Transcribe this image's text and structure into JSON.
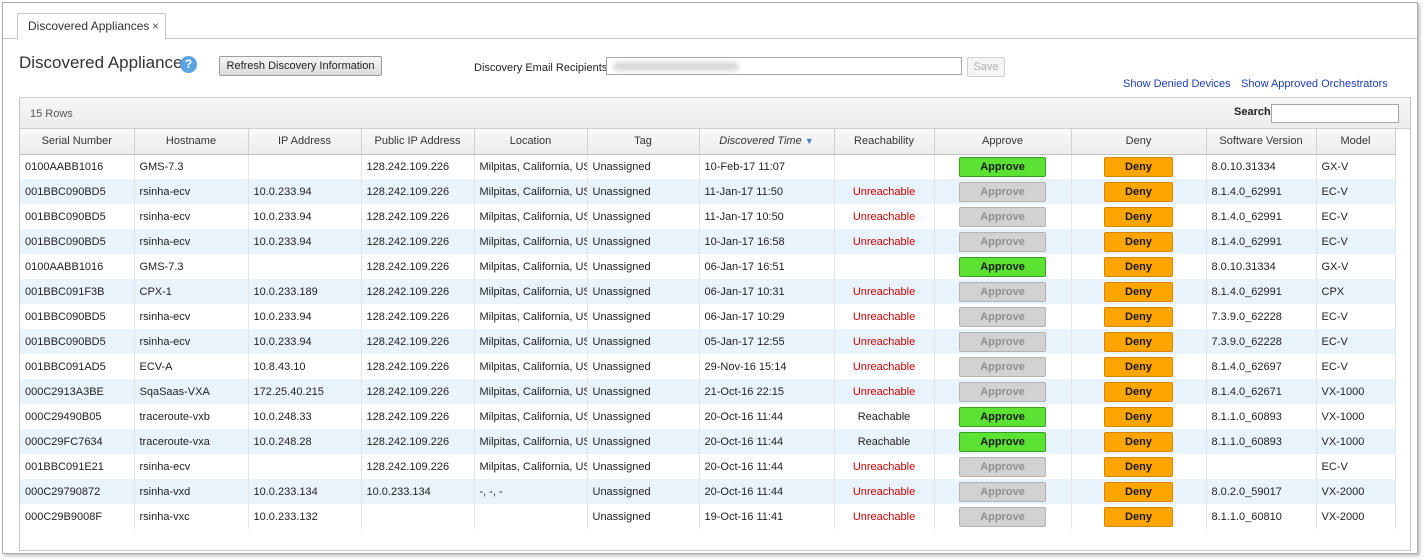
{
  "tab": {
    "label": "Discovered Appliances",
    "close": "×"
  },
  "page": {
    "title": "Discovered Appliances",
    "help": "?",
    "refresh_label": "Refresh Discovery Information",
    "email_label": "Discovery Email Recipients",
    "email_value": "",
    "save_label": "Save",
    "link_denied": "Show Denied Devices",
    "link_orchestrators": "Show Approved Orchestrators"
  },
  "grid": {
    "rows_label": "15 Rows",
    "search_label": "Search",
    "search_value": "",
    "sort_indicator": "▼",
    "columns": [
      "Serial Number",
      "Hostname",
      "IP Address",
      "Public IP Address",
      "Location",
      "Tag",
      "Discovered Time",
      "Reachability",
      "Approve",
      "Deny",
      "Software Version",
      "Model"
    ],
    "rows": [
      {
        "serial": "0100AABB1016",
        "host": "GMS-7.3",
        "ip": "",
        "pubip": "128.242.109.226",
        "loc": "Milpitas, California, US",
        "tag": "Unassigned",
        "time": "10-Feb-17 11:07",
        "reach": "",
        "approve": "Approve",
        "approve_enabled": true,
        "deny": "Deny",
        "ver": "8.0.10.31334",
        "model": "GX-V"
      },
      {
        "serial": "001BBC090BD5",
        "host": "rsinha-ecv",
        "ip": "10.0.233.94",
        "pubip": "128.242.109.226",
        "loc": "Milpitas, California, US",
        "tag": "Unassigned",
        "time": "11-Jan-17 11:50",
        "reach": "Unreachable",
        "approve": "Approve",
        "approve_enabled": false,
        "deny": "Deny",
        "ver": "8.1.4.0_62991",
        "model": "EC-V"
      },
      {
        "serial": "001BBC090BD5",
        "host": "rsinha-ecv",
        "ip": "10.0.233.94",
        "pubip": "128.242.109.226",
        "loc": "Milpitas, California, US",
        "tag": "Unassigned",
        "time": "11-Jan-17 10:50",
        "reach": "Unreachable",
        "approve": "Approve",
        "approve_enabled": false,
        "deny": "Deny",
        "ver": "8.1.4.0_62991",
        "model": "EC-V"
      },
      {
        "serial": "001BBC090BD5",
        "host": "rsinha-ecv",
        "ip": "10.0.233.94",
        "pubip": "128.242.109.226",
        "loc": "Milpitas, California, US",
        "tag": "Unassigned",
        "time": "10-Jan-17 16:58",
        "reach": "Unreachable",
        "approve": "Approve",
        "approve_enabled": false,
        "deny": "Deny",
        "ver": "8.1.4.0_62991",
        "model": "EC-V"
      },
      {
        "serial": "0100AABB1016",
        "host": "GMS-7.3",
        "ip": "",
        "pubip": "128.242.109.226",
        "loc": "Milpitas, California, US",
        "tag": "Unassigned",
        "time": "06-Jan-17 16:51",
        "reach": "",
        "approve": "Approve",
        "approve_enabled": true,
        "deny": "Deny",
        "ver": "8.0.10.31334",
        "model": "GX-V"
      },
      {
        "serial": "001BBC091F3B",
        "host": "CPX-1",
        "ip": "10.0.233.189",
        "pubip": "128.242.109.226",
        "loc": "Milpitas, California, US",
        "tag": "Unassigned",
        "time": "06-Jan-17 10:31",
        "reach": "Unreachable",
        "approve": "Approve",
        "approve_enabled": false,
        "deny": "Deny",
        "ver": "8.1.4.0_62991",
        "model": "CPX"
      },
      {
        "serial": "001BBC090BD5",
        "host": "rsinha-ecv",
        "ip": "10.0.233.94",
        "pubip": "128.242.109.226",
        "loc": "Milpitas, California, US",
        "tag": "Unassigned",
        "time": "06-Jan-17 10:29",
        "reach": "Unreachable",
        "approve": "Approve",
        "approve_enabled": false,
        "deny": "Deny",
        "ver": "7.3.9.0_62228",
        "model": "EC-V"
      },
      {
        "serial": "001BBC090BD5",
        "host": "rsinha-ecv",
        "ip": "10.0.233.94",
        "pubip": "128.242.109.226",
        "loc": "Milpitas, California, US",
        "tag": "Unassigned",
        "time": "05-Jan-17 12:55",
        "reach": "Unreachable",
        "approve": "Approve",
        "approve_enabled": false,
        "deny": "Deny",
        "ver": "7.3.9.0_62228",
        "model": "EC-V"
      },
      {
        "serial": "001BBC091AD5",
        "host": "ECV-A",
        "ip": "10.8.43.10",
        "pubip": "128.242.109.226",
        "loc": "Milpitas, California, US",
        "tag": "Unassigned",
        "time": "29-Nov-16 15:14",
        "reach": "Unreachable",
        "approve": "Approve",
        "approve_enabled": false,
        "deny": "Deny",
        "ver": "8.1.4.0_62697",
        "model": "EC-V"
      },
      {
        "serial": "000C2913A3BE",
        "host": "SqaSaas-VXA",
        "ip": "172.25.40.215",
        "pubip": "128.242.109.226",
        "loc": "Milpitas, California, US",
        "tag": "Unassigned",
        "time": "21-Oct-16 22:15",
        "reach": "Unreachable",
        "approve": "Approve",
        "approve_enabled": false,
        "deny": "Deny",
        "ver": "8.1.4.0_62671",
        "model": "VX-1000"
      },
      {
        "serial": "000C29490B05",
        "host": "traceroute-vxb",
        "ip": "10.0.248.33",
        "pubip": "128.242.109.226",
        "loc": "Milpitas, California, US",
        "tag": "Unassigned",
        "time": "20-Oct-16 11:44",
        "reach": "Reachable",
        "approve": "Approve",
        "approve_enabled": true,
        "deny": "Deny",
        "ver": "8.1.1.0_60893",
        "model": "VX-1000"
      },
      {
        "serial": "000C29FC7634",
        "host": "traceroute-vxa",
        "ip": "10.0.248.28",
        "pubip": "128.242.109.226",
        "loc": "Milpitas, California, US",
        "tag": "Unassigned",
        "time": "20-Oct-16 11:44",
        "reach": "Reachable",
        "approve": "Approve",
        "approve_enabled": true,
        "deny": "Deny",
        "ver": "8.1.1.0_60893",
        "model": "VX-1000"
      },
      {
        "serial": "001BBC091E21",
        "host": "rsinha-ecv",
        "ip": "",
        "pubip": "128.242.109.226",
        "loc": "Milpitas, California, US",
        "tag": "Unassigned",
        "time": "20-Oct-16 11:44",
        "reach": "Unreachable",
        "approve": "Approve",
        "approve_enabled": false,
        "deny": "Deny",
        "ver": "",
        "model": "EC-V"
      },
      {
        "serial": "000C29790872",
        "host": "rsinha-vxd",
        "ip": "10.0.233.134",
        "pubip": "10.0.233.134",
        "loc": "-, -, -",
        "tag": "Unassigned",
        "time": "20-Oct-16 11:44",
        "reach": "Unreachable",
        "approve": "Approve",
        "approve_enabled": false,
        "deny": "Deny",
        "ver": "8.0.2.0_59017",
        "model": "VX-2000"
      },
      {
        "serial": "000C29B9008F",
        "host": "rsinha-vxc",
        "ip": "10.0.233.132",
        "pubip": "",
        "loc": "",
        "tag": "Unassigned",
        "time": "19-Oct-16 11:41",
        "reach": "Unreachable",
        "approve": "Approve",
        "approve_enabled": false,
        "deny": "Deny",
        "ver": "8.1.1.0_60810",
        "model": "VX-2000"
      }
    ]
  },
  "colors": {
    "approve": "#5ce232",
    "approve_disabled": "#d2d2d2",
    "deny": "#ffa500",
    "unreachable": "#d10000",
    "link": "#1f3fb8",
    "row_alt": "#e9f3fc"
  }
}
